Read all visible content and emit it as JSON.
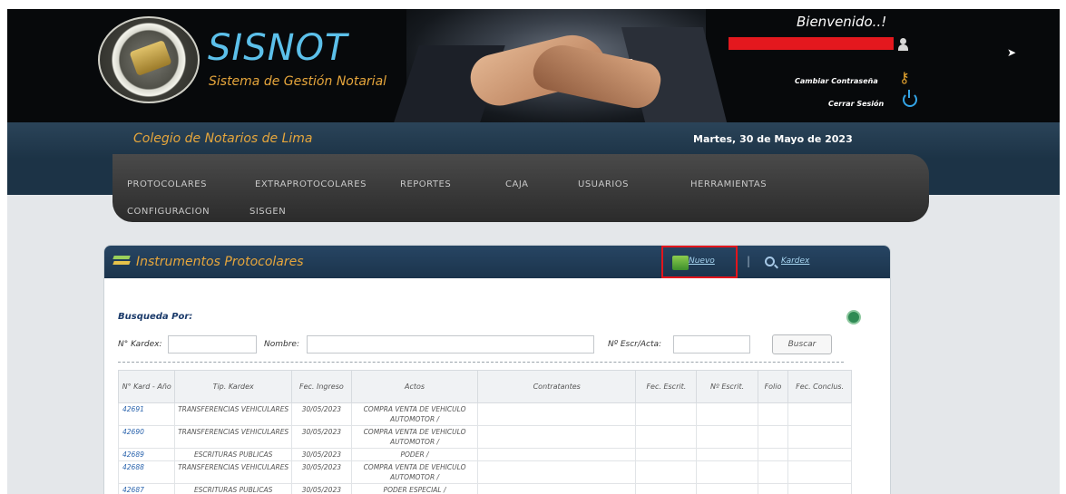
{
  "app": {
    "name": "SISNOT",
    "subtitle": "Sistema de Gestión Notarial",
    "welcome": "Bienvenido..!",
    "change_password": "Cambiar Contraseña",
    "logout": "Cerrar Sesión",
    "org": "Colegio de Notarios de Lima",
    "date": "Martes, 30 de Mayo de 2023"
  },
  "nav": {
    "items": [
      "PROTOCOLARES",
      "EXTRAPROTOCOLARES",
      "REPORTES",
      "CAJA",
      "USUARIOS",
      "HERRAMIENTAS",
      "CONFIGURACION",
      "SISGEN"
    ]
  },
  "panel": {
    "title": "Instrumentos Protocolares",
    "new_label": "Nuevo",
    "separator": "|",
    "kardex_label": "Kardex"
  },
  "search": {
    "heading": "Busqueda Por:",
    "kardex_label": "N° Kardex:",
    "name_label": "Nombre:",
    "escr_label": "Nº Escr/Acta:",
    "button": "Buscar",
    "kardex_value": "",
    "name_value": "",
    "escr_value": ""
  },
  "table": {
    "headers": [
      "N° Kard - Año",
      "Tip. Kardex",
      "Fec. Ingreso",
      "Actos",
      "Contratantes",
      "Fec. Escrit.",
      "Nº Escrit.",
      "Folio",
      "Fec. Conclus."
    ],
    "rows": [
      [
        "42691",
        "TRANSFERENCIAS VEHICULARES",
        "30/05/2023",
        "COMPRA VENTA DE VEHICULO AUTOMOTOR /",
        "",
        "",
        "",
        "",
        ""
      ],
      [
        "42690",
        "TRANSFERENCIAS VEHICULARES",
        "30/05/2023",
        "COMPRA VENTA DE VEHICULO AUTOMOTOR /",
        "",
        "",
        "",
        "",
        ""
      ],
      [
        "42689",
        "ESCRITURAS PUBLICAS",
        "30/05/2023",
        "PODER /",
        "",
        "",
        "",
        "",
        ""
      ],
      [
        "42688",
        "TRANSFERENCIAS VEHICULARES",
        "30/05/2023",
        "COMPRA VENTA DE VEHICULO AUTOMOTOR /",
        "",
        "",
        "",
        "",
        ""
      ],
      [
        "42687",
        "ESCRITURAS PUBLICAS",
        "30/05/2023",
        "PODER ESPECIAL /",
        "",
        "",
        "",
        "",
        ""
      ]
    ]
  },
  "colors": {
    "banner": "#07090b",
    "title_blue": "#5cc0ea",
    "accent_orange": "#e6a63c",
    "highlight_red": "#e3151c",
    "link_blue": "#2b64ad"
  },
  "icons": [
    "seal-logo",
    "user-icon",
    "key-icon",
    "power-icon",
    "layers-icon",
    "new-document-icon",
    "search-icon",
    "print-icon",
    "cursor-icon"
  ]
}
